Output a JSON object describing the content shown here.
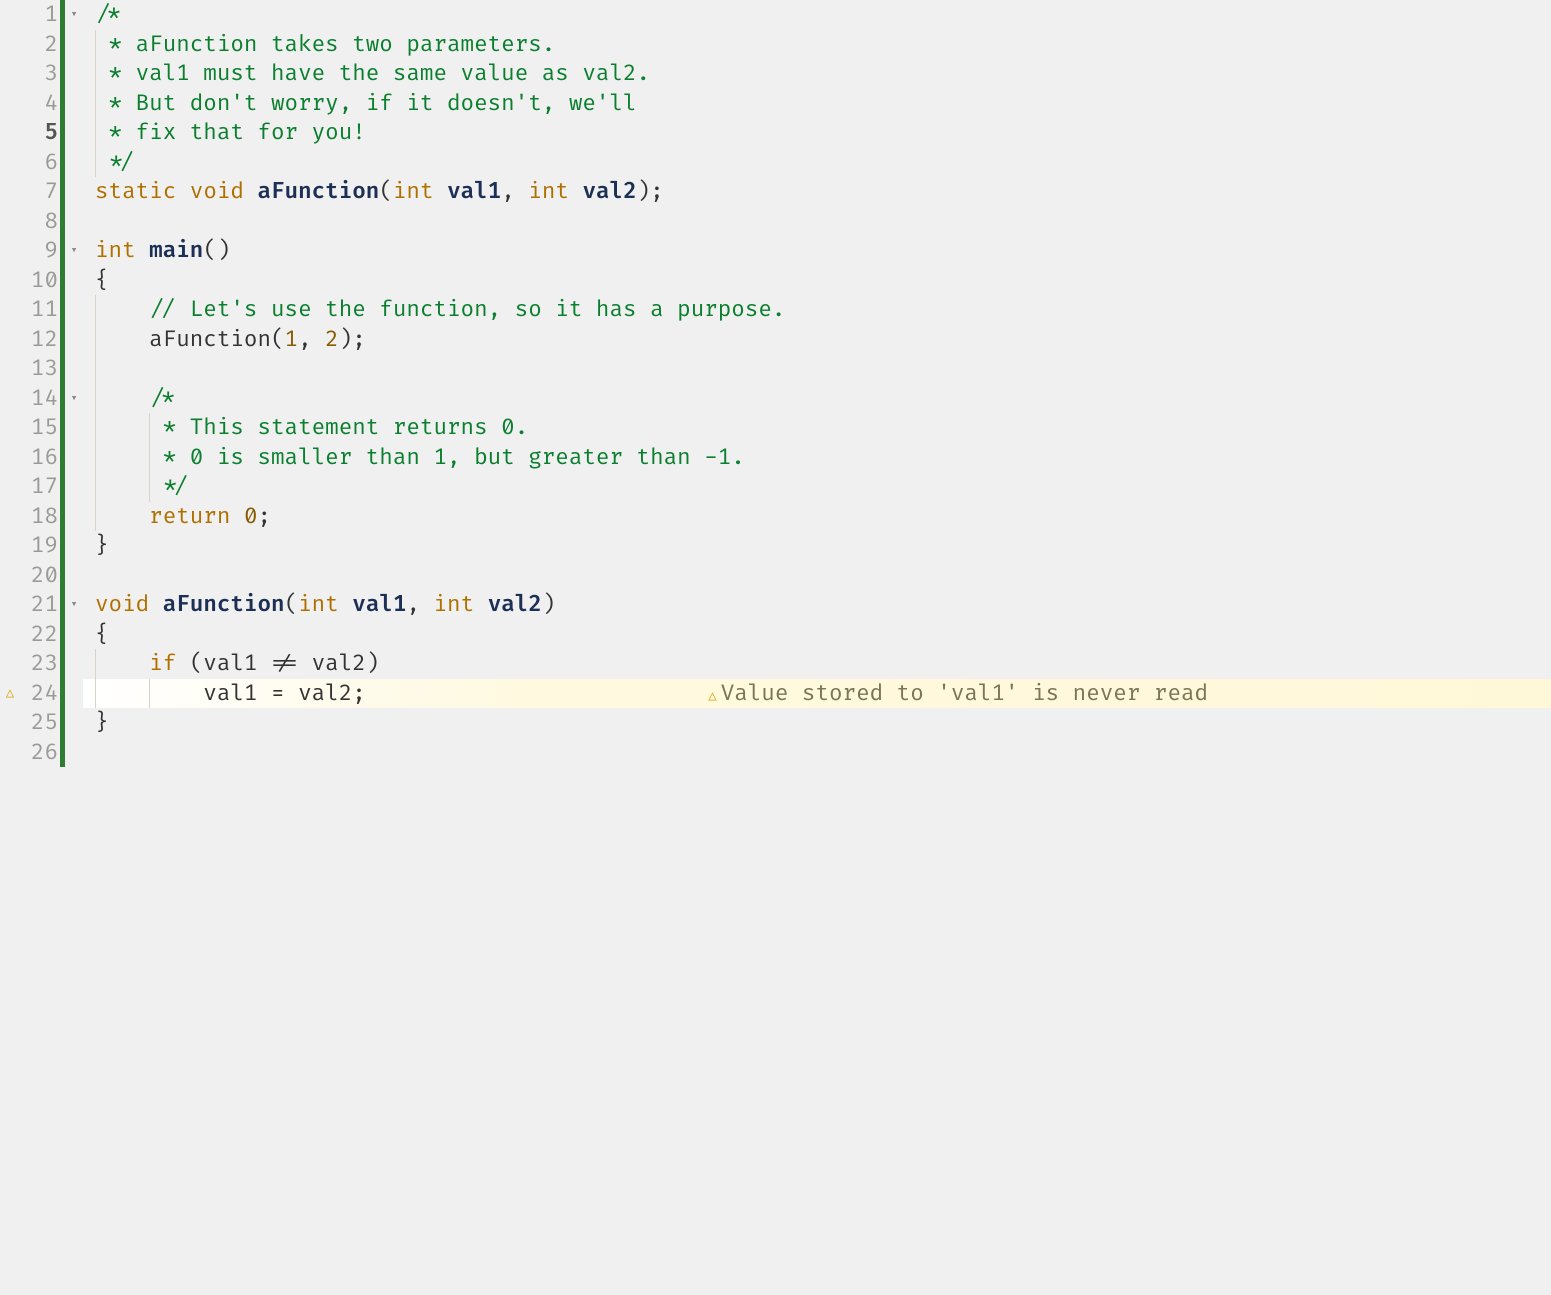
{
  "editor": {
    "warning_icon": "△",
    "fold_icon": "▾",
    "inline_warning": {
      "icon": "△",
      "text": "Value stored to 'val1' is never read"
    },
    "lines": [
      {
        "n": "1",
        "fold": true,
        "warn": false,
        "bold": false,
        "guides": [],
        "tokens": [
          {
            "cls": "c-comment",
            "t": "/*"
          }
        ]
      },
      {
        "n": "2",
        "fold": false,
        "warn": false,
        "bold": false,
        "guides": [
          1
        ],
        "tokens": [
          {
            "cls": "c-comment",
            "t": " * aFunction takes two parameters."
          }
        ]
      },
      {
        "n": "3",
        "fold": false,
        "warn": false,
        "bold": false,
        "guides": [
          1
        ],
        "tokens": [
          {
            "cls": "c-comment",
            "t": " * val1 must have the same value as val2."
          }
        ]
      },
      {
        "n": "4",
        "fold": false,
        "warn": false,
        "bold": false,
        "guides": [
          1
        ],
        "tokens": [
          {
            "cls": "c-comment",
            "t": " * But don't worry, if it doesn't, we'll"
          }
        ]
      },
      {
        "n": "5",
        "fold": false,
        "warn": false,
        "bold": true,
        "guides": [
          1
        ],
        "tokens": [
          {
            "cls": "c-comment",
            "t": " * fix that for you!"
          }
        ]
      },
      {
        "n": "6",
        "fold": false,
        "warn": false,
        "bold": false,
        "guides": [
          1
        ],
        "tokens": [
          {
            "cls": "c-comment",
            "t": " */"
          }
        ]
      },
      {
        "n": "7",
        "fold": false,
        "warn": false,
        "bold": false,
        "guides": [],
        "tokens": [
          {
            "cls": "c-keyword",
            "t": "static"
          },
          {
            "cls": "c-plain",
            "t": " "
          },
          {
            "cls": "c-type",
            "t": "void"
          },
          {
            "cls": "c-plain",
            "t": " "
          },
          {
            "cls": "c-funcname",
            "t": "aFunction"
          },
          {
            "cls": "c-punct",
            "t": "("
          },
          {
            "cls": "c-type",
            "t": "int"
          },
          {
            "cls": "c-plain",
            "t": " "
          },
          {
            "cls": "c-param",
            "t": "val1"
          },
          {
            "cls": "c-punct",
            "t": ", "
          },
          {
            "cls": "c-type",
            "t": "int"
          },
          {
            "cls": "c-plain",
            "t": " "
          },
          {
            "cls": "c-param",
            "t": "val2"
          },
          {
            "cls": "c-punct",
            "t": ");"
          }
        ]
      },
      {
        "n": "8",
        "fold": false,
        "warn": false,
        "bold": false,
        "guides": [],
        "tokens": [
          {
            "cls": "c-plain",
            "t": ""
          }
        ]
      },
      {
        "n": "9",
        "fold": true,
        "warn": false,
        "bold": false,
        "guides": [],
        "tokens": [
          {
            "cls": "c-type",
            "t": "int"
          },
          {
            "cls": "c-plain",
            "t": " "
          },
          {
            "cls": "c-funcname",
            "t": "main"
          },
          {
            "cls": "c-punct",
            "t": "()"
          }
        ]
      },
      {
        "n": "10",
        "fold": false,
        "warn": false,
        "bold": false,
        "guides": [],
        "tokens": [
          {
            "cls": "c-punct",
            "t": "{"
          }
        ]
      },
      {
        "n": "11",
        "fold": false,
        "warn": false,
        "bold": false,
        "guides": [
          1
        ],
        "tokens": [
          {
            "cls": "c-plain",
            "t": "    "
          },
          {
            "cls": "c-comment",
            "t": "// Let's use the function, so it has a purpose."
          }
        ]
      },
      {
        "n": "12",
        "fold": false,
        "warn": false,
        "bold": false,
        "guides": [
          1
        ],
        "tokens": [
          {
            "cls": "c-plain",
            "t": "    aFunction("
          },
          {
            "cls": "c-number",
            "t": "1"
          },
          {
            "cls": "c-punct",
            "t": ", "
          },
          {
            "cls": "c-number",
            "t": "2"
          },
          {
            "cls": "c-punct",
            "t": ");"
          }
        ]
      },
      {
        "n": "13",
        "fold": false,
        "warn": false,
        "bold": false,
        "guides": [
          1
        ],
        "tokens": [
          {
            "cls": "c-plain",
            "t": ""
          }
        ]
      },
      {
        "n": "14",
        "fold": true,
        "warn": false,
        "bold": false,
        "guides": [
          1
        ],
        "tokens": [
          {
            "cls": "c-plain",
            "t": "    "
          },
          {
            "cls": "c-comment",
            "t": "/*"
          }
        ]
      },
      {
        "n": "15",
        "fold": false,
        "warn": false,
        "bold": false,
        "guides": [
          1,
          2
        ],
        "tokens": [
          {
            "cls": "c-plain",
            "t": "    "
          },
          {
            "cls": "c-comment",
            "t": " * This statement returns 0."
          }
        ]
      },
      {
        "n": "16",
        "fold": false,
        "warn": false,
        "bold": false,
        "guides": [
          1,
          2
        ],
        "tokens": [
          {
            "cls": "c-plain",
            "t": "    "
          },
          {
            "cls": "c-comment",
            "t": " * 0 is smaller than 1, but greater than -1."
          }
        ]
      },
      {
        "n": "17",
        "fold": false,
        "warn": false,
        "bold": false,
        "guides": [
          1,
          2
        ],
        "tokens": [
          {
            "cls": "c-plain",
            "t": "    "
          },
          {
            "cls": "c-comment",
            "t": " */"
          }
        ]
      },
      {
        "n": "18",
        "fold": false,
        "warn": false,
        "bold": false,
        "guides": [
          1
        ],
        "tokens": [
          {
            "cls": "c-plain",
            "t": "    "
          },
          {
            "cls": "c-keyword",
            "t": "return"
          },
          {
            "cls": "c-plain",
            "t": " "
          },
          {
            "cls": "c-number",
            "t": "0"
          },
          {
            "cls": "c-punct",
            "t": ";"
          }
        ]
      },
      {
        "n": "19",
        "fold": false,
        "warn": false,
        "bold": false,
        "guides": [],
        "tokens": [
          {
            "cls": "c-punct",
            "t": "}"
          }
        ]
      },
      {
        "n": "20",
        "fold": false,
        "warn": false,
        "bold": false,
        "guides": [],
        "tokens": [
          {
            "cls": "c-plain",
            "t": ""
          }
        ]
      },
      {
        "n": "21",
        "fold": true,
        "warn": false,
        "bold": false,
        "guides": [],
        "tokens": [
          {
            "cls": "c-type",
            "t": "void"
          },
          {
            "cls": "c-plain",
            "t": " "
          },
          {
            "cls": "c-funcname",
            "t": "aFunction"
          },
          {
            "cls": "c-punct",
            "t": "("
          },
          {
            "cls": "c-type",
            "t": "int"
          },
          {
            "cls": "c-plain",
            "t": " "
          },
          {
            "cls": "c-param",
            "t": "val1"
          },
          {
            "cls": "c-punct",
            "t": ", "
          },
          {
            "cls": "c-type",
            "t": "int"
          },
          {
            "cls": "c-plain",
            "t": " "
          },
          {
            "cls": "c-param",
            "t": "val2"
          },
          {
            "cls": "c-punct",
            "t": ")"
          }
        ]
      },
      {
        "n": "22",
        "fold": false,
        "warn": false,
        "bold": false,
        "guides": [],
        "tokens": [
          {
            "cls": "c-punct",
            "t": "{"
          }
        ]
      },
      {
        "n": "23",
        "fold": false,
        "warn": false,
        "bold": false,
        "guides": [
          1
        ],
        "tokens": [
          {
            "cls": "c-plain",
            "t": "    "
          },
          {
            "cls": "c-keyword",
            "t": "if"
          },
          {
            "cls": "c-plain",
            "t": " (val1 != val2)"
          }
        ]
      },
      {
        "n": "24",
        "fold": false,
        "warn": true,
        "bold": false,
        "guides": [
          1,
          2
        ],
        "tokens": [
          {
            "cls": "c-plain",
            "t": "        val1 = val2;"
          }
        ],
        "inline_warn": true
      },
      {
        "n": "25",
        "fold": false,
        "warn": false,
        "bold": false,
        "guides": [],
        "tokens": [
          {
            "cls": "c-punct",
            "t": "}"
          }
        ]
      },
      {
        "n": "26",
        "fold": false,
        "warn": false,
        "bold": false,
        "guides": [],
        "tokens": [
          {
            "cls": "c-plain",
            "t": ""
          }
        ]
      }
    ]
  }
}
